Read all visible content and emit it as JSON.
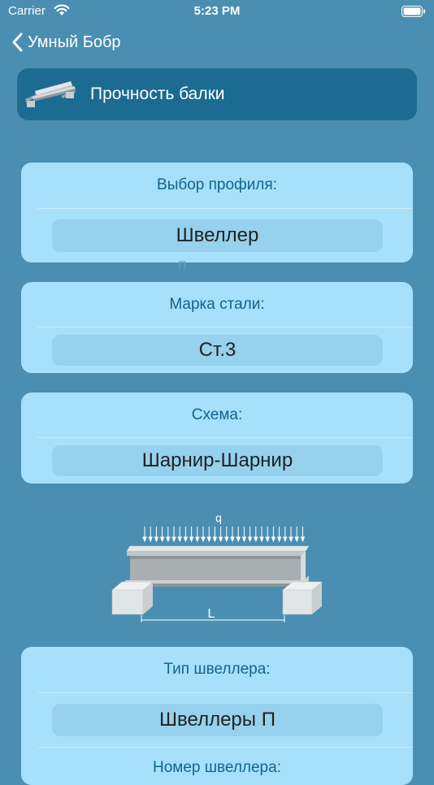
{
  "status": {
    "carrier": "Carrier",
    "time": "5:23 PM"
  },
  "nav": {
    "back_label": "Умный Бобр"
  },
  "header": {
    "title": "Прочность балки"
  },
  "profile": {
    "label": "Выбор профиля:",
    "value": "Швеллер",
    "ghost": "П"
  },
  "steel": {
    "label": "Марка стали:",
    "value": "Ст.3"
  },
  "scheme": {
    "label": "Схема:",
    "value": "Шарнир-Шарнир"
  },
  "diagram": {
    "load_label": "q",
    "length_label": "L"
  },
  "channel": {
    "label": "Тип швеллера:",
    "value": "Швеллеры П",
    "next_label": "Номер швеллера:"
  },
  "colors": {
    "background": "#4a8fb2",
    "header": "#1b6b93",
    "card": "#a6e0fb",
    "value_box": "#96d1ee",
    "label_text": "#13648a"
  }
}
